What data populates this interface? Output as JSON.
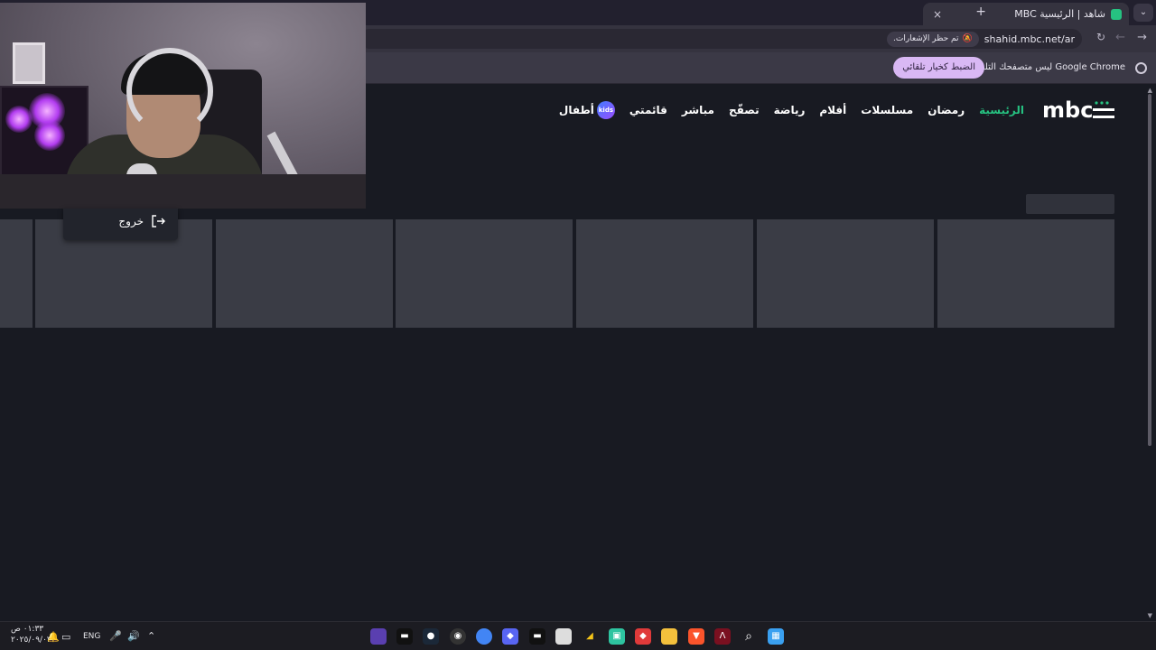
{
  "browser": {
    "tab": {
      "title": "شاهد | الرئيسية MBC"
    },
    "new_tab_symbol": "+",
    "close_symbol": "×",
    "tab_search_symbol": "⌄",
    "address": {
      "url": "shahid.mbc.net/ar",
      "notification_chip": "تم حظر الإشعارات."
    },
    "infobar": {
      "message": "Google Chrome ليس متصفحك التلقائي.",
      "button": "الضبط كخيار تلقائي"
    }
  },
  "site": {
    "logo": "mbc",
    "nav": [
      {
        "label": "الرئيسية",
        "active": true
      },
      {
        "label": "رمضان"
      },
      {
        "label": "مسلسلات"
      },
      {
        "label": "أفلام"
      },
      {
        "label": "رياضة"
      },
      {
        "label": "تصفّح"
      },
      {
        "label": "مباشر"
      },
      {
        "label": "قائمتي"
      }
    ],
    "kids": {
      "badge": "kids",
      "label": "أطفال"
    }
  },
  "exit_menu": {
    "label": "خروج"
  },
  "taskbar": {
    "time": "٠١:٣٣ ص",
    "date": "٢٠٢٥/٠٩/٠٣",
    "language": "ENG",
    "colors": {
      "accent_green": "#26c281",
      "card": "#3a3c45",
      "background": "#181a22"
    }
  }
}
